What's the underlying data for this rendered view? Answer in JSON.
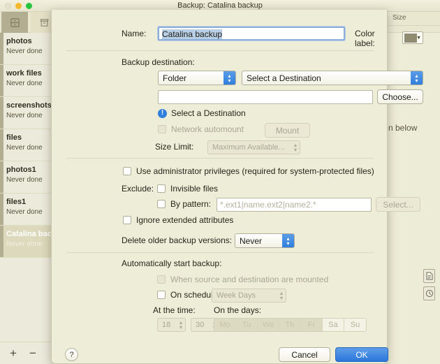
{
  "window": {
    "title": "Backup: Catalina backup",
    "traffic_lights": [
      "close",
      "minimize",
      "maximize"
    ],
    "toolbar_icons": [
      "drawer-icon",
      "archive-box-icon"
    ],
    "column_header_size": "Size",
    "behind_text": "n below",
    "side_icons": [
      "document-icon",
      "clock-icon"
    ],
    "footer": {
      "add": "+",
      "remove": "−"
    }
  },
  "sidebar": {
    "tasks": [
      {
        "name": "photos",
        "status": "Never done",
        "selected": false
      },
      {
        "name": "work files",
        "status": "Never done",
        "selected": false
      },
      {
        "name": "screenshots",
        "status": "Never done",
        "selected": false
      },
      {
        "name": "files",
        "status": "Never done",
        "selected": false
      },
      {
        "name": "photos1",
        "status": "Never done",
        "selected": false
      },
      {
        "name": "files1",
        "status": "Never done",
        "selected": false
      },
      {
        "name": "Catalina backup",
        "status": "Never done",
        "selected": true
      }
    ]
  },
  "dialog": {
    "name_label": "Name:",
    "name_value": "Catalina backup",
    "color_label": "Color label:",
    "color_swatch": "#8f8c72",
    "destination": {
      "section_label": "Backup destination:",
      "type_value": "Folder",
      "target_value": "Select a Destination",
      "path_value": "",
      "choose_label": "Choose...",
      "warning_text": "Select a Destination",
      "warning_icon": "info-icon",
      "automount_label": "Network automount",
      "automount_checked": false,
      "mount_label": "Mount",
      "size_limit_label": "Size Limit:",
      "size_limit_value": "Maximum Available..."
    },
    "options": {
      "admin_label": "Use administrator privileges (required for system-protected files)",
      "admin_checked": false,
      "exclude_label": "Exclude:",
      "invisible_label": "Invisible files",
      "invisible_checked": false,
      "pattern_label": "By pattern:",
      "pattern_checked": false,
      "pattern_placeholder": "*.ext1|name.ext2|name2.*",
      "select_label": "Select...",
      "xattr_label": "Ignore extended attributes",
      "xattr_checked": false,
      "delete_label": "Delete older backup versions:",
      "delete_value": "Never"
    },
    "schedule": {
      "section_label": "Automatically start backup:",
      "mounted_label": "When source and destination are mounted",
      "mounted_checked": false,
      "on_schedule_label": "On schedule",
      "on_schedule_checked": false,
      "frequency_value": "Week Days",
      "time_label": "At the time:",
      "hour_value": "18",
      "minute_value": "30",
      "days_label": "On the days:",
      "days": [
        {
          "label": "Mo",
          "selected": true
        },
        {
          "label": "Tu",
          "selected": true
        },
        {
          "label": "We",
          "selected": true
        },
        {
          "label": "Th",
          "selected": true
        },
        {
          "label": "Fr",
          "selected": true
        },
        {
          "label": "Sa",
          "selected": false
        },
        {
          "label": "Su",
          "selected": false
        }
      ]
    },
    "footer": {
      "help_label": "?",
      "cancel_label": "Cancel",
      "ok_label": "OK"
    }
  }
}
